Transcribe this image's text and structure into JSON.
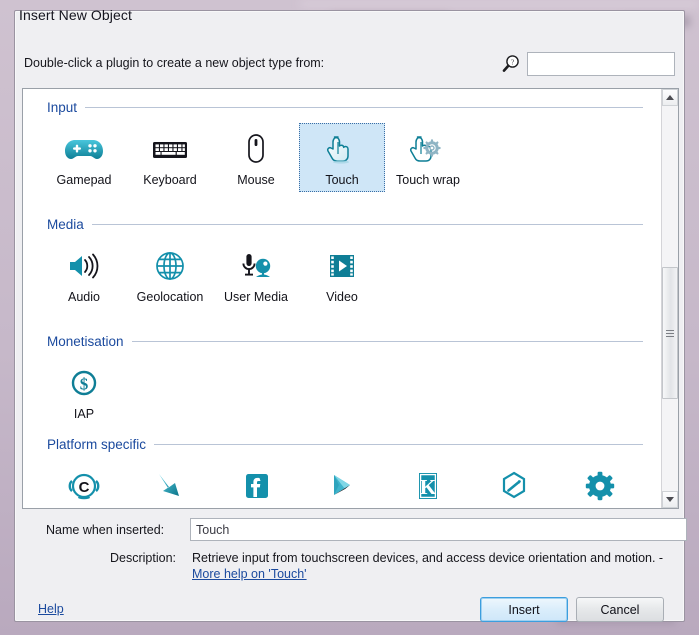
{
  "window": {
    "title": "Insert New Object"
  },
  "prompt": "Double-click a plugin to create a new object type from:",
  "search": {
    "icon": "search-help-icon",
    "value": "",
    "placeholder": ""
  },
  "sections": [
    {
      "title": "Input",
      "items": [
        {
          "label": "Gamepad",
          "icon": "gamepad-icon",
          "selected": false
        },
        {
          "label": "Keyboard",
          "icon": "keyboard-icon",
          "selected": false
        },
        {
          "label": "Mouse",
          "icon": "mouse-icon",
          "selected": false
        },
        {
          "label": "Touch",
          "icon": "touch-icon",
          "selected": true
        },
        {
          "label": "Touch wrap",
          "icon": "touch-wrap-icon",
          "selected": false
        }
      ]
    },
    {
      "title": "Media",
      "items": [
        {
          "label": "Audio",
          "icon": "speaker-icon",
          "selected": false
        },
        {
          "label": "Geolocation",
          "icon": "globe-icon",
          "selected": false
        },
        {
          "label": "User Media",
          "icon": "mic-webcam-icon",
          "selected": false
        },
        {
          "label": "Video",
          "icon": "film-play-icon",
          "selected": false
        }
      ]
    },
    {
      "title": "Monetisation",
      "items": [
        {
          "label": "IAP",
          "icon": "dollar-coin-icon",
          "selected": false
        }
      ]
    },
    {
      "title": "Platform specific",
      "items": [
        {
          "label": "",
          "icon": "cocoon-c-icon",
          "selected": false
        },
        {
          "label": "",
          "icon": "arrow-down-icon",
          "selected": false
        },
        {
          "label": "",
          "icon": "facebook-icon",
          "selected": false
        },
        {
          "label": "",
          "icon": "google-play-icon",
          "selected": false
        },
        {
          "label": "",
          "icon": "kongregate-k-icon",
          "selected": false
        },
        {
          "label": "",
          "icon": "hexagon-icon",
          "selected": false
        },
        {
          "label": "",
          "icon": "gear-icon",
          "selected": false
        }
      ]
    }
  ],
  "scrollbar": {
    "up_icon": "chevron-up-icon",
    "down_icon": "chevron-down-icon",
    "thumb_grip_icon": "grip-icon"
  },
  "form": {
    "name_label": "Name when inserted:",
    "name_value": "Touch",
    "description_label": "Description:",
    "description_text": "Retrieve input from touchscreen devices, and access device orientation and motion. -",
    "description_link": "More help on 'Touch'"
  },
  "footer": {
    "help_label": "Help",
    "insert_label": "Insert",
    "cancel_label": "Cancel"
  },
  "colors": {
    "accent_teal": "#1a93ad",
    "section_blue": "#1b4a9e",
    "selection_blue": "#cfe6f7",
    "link_blue": "#1b4a9e",
    "dialog_bg": "#efeff2"
  }
}
